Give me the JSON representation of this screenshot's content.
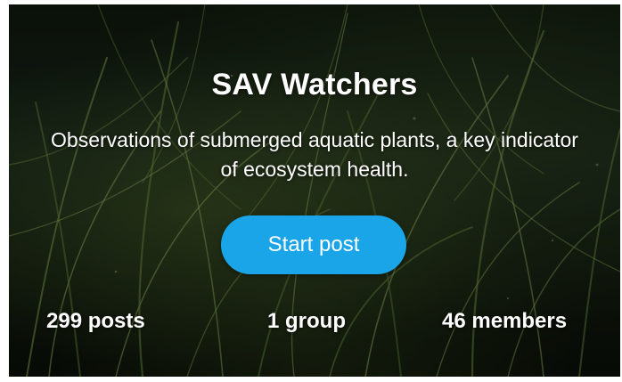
{
  "header": {
    "title": "SAV Watchers",
    "description": "Observations of submerged aquatic plants, a key indicator of ecosystem health."
  },
  "actions": {
    "start_post_label": "Start post",
    "button_color": "#1aa5e8"
  },
  "stats": {
    "posts": "299 posts",
    "groups": "1 group",
    "members": "46 members"
  },
  "background": {
    "description_icon": "seagrass-background-image"
  }
}
